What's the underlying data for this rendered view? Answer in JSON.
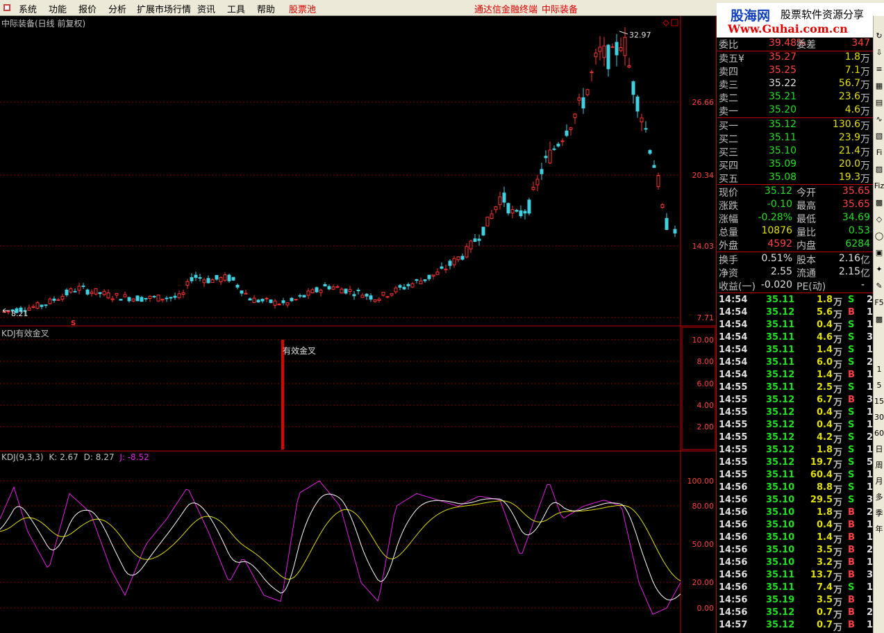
{
  "menu": {
    "items": [
      "系统",
      "功能",
      "报价",
      "分析",
      "扩展市场行情",
      "资讯",
      "工具",
      "帮助"
    ],
    "highlight": "股票池",
    "center_links": [
      "通达信金融终端",
      "中际装备"
    ]
  },
  "logo": {
    "name": "股海网",
    "slogan": "股票软件资源分享",
    "url": "Www.Guhai.com.cn"
  },
  "main_chart": {
    "title": "中际装备(日线 前复权)",
    "price_labels": [
      "26.66",
      "20.34",
      "14.03",
      "7.71"
    ],
    "high_label": "32.97",
    "low_label": "8.21",
    "marker": "S"
  },
  "kdj_cross": {
    "title": "KDJ有效金叉",
    "y_labels": [
      "10.00",
      "8.00",
      "6.00",
      "4.00",
      "2.00"
    ],
    "signal_label": "有效金叉"
  },
  "kdj": {
    "name": "KDJ(9,3,3)",
    "k": "K: 2.67",
    "d": "D: 8.27",
    "j": "J: -8.52",
    "y_labels": [
      "100.00",
      "80.00",
      "50.00",
      "20.00",
      "0.00"
    ]
  },
  "quote": {
    "weibi_label": "委比",
    "weibi": "39.48%",
    "weicha_label": "委差",
    "weicha": "347",
    "asks": [
      {
        "label": "卖五",
        "extra": "¥",
        "price": "35.27",
        "vol": "1.8",
        "unit": "万"
      },
      {
        "label": "卖四",
        "extra": "",
        "price": "35.25",
        "vol": "7.1",
        "unit": "万"
      },
      {
        "label": "卖三",
        "extra": "",
        "price": "35.22",
        "vol": "56.7",
        "unit": "万"
      },
      {
        "label": "卖二",
        "extra": "",
        "price": "35.21",
        "vol": "23.6",
        "unit": "万"
      },
      {
        "label": "卖一",
        "extra": "",
        "price": "35.20",
        "vol": "4.6",
        "unit": "万"
      }
    ],
    "bids": [
      {
        "label": "买一",
        "price": "35.12",
        "vol": "130.6",
        "unit": "万"
      },
      {
        "label": "买二",
        "price": "35.11",
        "vol": "23.9",
        "unit": "万"
      },
      {
        "label": "买三",
        "price": "35.10",
        "vol": "21.4",
        "unit": "万"
      },
      {
        "label": "买四",
        "price": "35.09",
        "vol": "20.0",
        "unit": "万"
      },
      {
        "label": "买五",
        "price": "35.08",
        "vol": "19.3",
        "unit": "万"
      }
    ],
    "stats": [
      {
        "l1": "现价",
        "v1": "35.12",
        "c1": "grn",
        "l2": "今开",
        "v2": "35.65",
        "c2": "red"
      },
      {
        "l1": "涨跌",
        "v1": "-0.10",
        "c1": "grn",
        "l2": "最高",
        "v2": "35.65",
        "c2": "red"
      },
      {
        "l1": "涨幅",
        "v1": "-0.28%",
        "c1": "grn",
        "l2": "最低",
        "v2": "34.69",
        "c2": "grn"
      },
      {
        "l1": "总量",
        "v1": "10876",
        "c1": "yel",
        "l2": "量比",
        "v2": "0.53",
        "c2": "grn"
      },
      {
        "l1": "外盘",
        "v1": "4592",
        "c1": "red",
        "l2": "内盘",
        "v2": "6284",
        "c2": "grn"
      }
    ],
    "stats2": [
      {
        "l1": "换手",
        "v1": "0.51%",
        "l2": "股本",
        "v2": "2.16",
        "u2": "亿"
      },
      {
        "l1": "净资",
        "v1": "2.55",
        "l2": "流通",
        "v2": "2.15",
        "u2": "亿"
      },
      {
        "l1": "收益(一)",
        "v1": "-0.020",
        "l2": "PE(动)",
        "v2": "-",
        "u2": ""
      }
    ],
    "ticks": [
      {
        "t": "14:54",
        "p": "35.11",
        "v": "1.8",
        "s": "S",
        "n": "2"
      },
      {
        "t": "14:54",
        "p": "35.12",
        "v": "5.6",
        "s": "B",
        "n": "1"
      },
      {
        "t": "14:54",
        "p": "35.11",
        "v": "0.4",
        "s": "S",
        "n": "1"
      },
      {
        "t": "14:54",
        "p": "35.11",
        "v": "4.6",
        "s": "S",
        "n": "3"
      },
      {
        "t": "14:54",
        "p": "35.11",
        "v": "1.4",
        "s": "S",
        "n": "1"
      },
      {
        "t": "14:54",
        "p": "35.11",
        "v": "6.0",
        "s": "S",
        "n": "2"
      },
      {
        "t": "14:54",
        "p": "35.12",
        "v": "1.4",
        "s": "B",
        "n": "1"
      },
      {
        "t": "14:55",
        "p": "35.11",
        "v": "2.5",
        "s": "S",
        "n": "1"
      },
      {
        "t": "14:55",
        "p": "35.12",
        "v": "6.7",
        "s": "B",
        "n": "3"
      },
      {
        "t": "14:55",
        "p": "35.12",
        "v": "0.4",
        "s": "S",
        "n": "1"
      },
      {
        "t": "14:55",
        "p": "35.12",
        "v": "0.4",
        "s": "S",
        "n": "1"
      },
      {
        "t": "14:55",
        "p": "35.12",
        "v": "4.2",
        "s": "S",
        "n": "2"
      },
      {
        "t": "14:55",
        "p": "35.12",
        "v": "1.8",
        "s": "S",
        "n": "1"
      },
      {
        "t": "14:55",
        "p": "35.12",
        "v": "19.7",
        "s": "S",
        "n": "5"
      },
      {
        "t": "14:55",
        "p": "35.11",
        "v": "60.4",
        "s": "S",
        "n": "1"
      },
      {
        "t": "14:56",
        "p": "35.10",
        "v": "8.8",
        "s": "S",
        "n": "1"
      },
      {
        "t": "14:56",
        "p": "35.10",
        "v": "29.5",
        "s": "S",
        "n": "3"
      },
      {
        "t": "14:56",
        "p": "35.10",
        "v": "1.8",
        "s": "B",
        "n": "2"
      },
      {
        "t": "14:56",
        "p": "35.10",
        "v": "0.4",
        "s": "B",
        "n": "1"
      },
      {
        "t": "14:56",
        "p": "35.10",
        "v": "1.4",
        "s": "B",
        "n": "1"
      },
      {
        "t": "14:56",
        "p": "35.10",
        "v": "3.5",
        "s": "B",
        "n": "2"
      },
      {
        "t": "14:56",
        "p": "35.10",
        "v": "3.2",
        "s": "B",
        "n": "1"
      },
      {
        "t": "14:56",
        "p": "35.11",
        "v": "13.7",
        "s": "B",
        "n": "3"
      },
      {
        "t": "14:56",
        "p": "35.11",
        "v": "7.4",
        "s": "S",
        "n": "1"
      },
      {
        "t": "14:56",
        "p": "35.19",
        "v": "3.5",
        "s": "B",
        "n": "1"
      },
      {
        "t": "14:56",
        "p": "35.12",
        "v": "0.7",
        "s": "B",
        "n": "2"
      },
      {
        "t": "14:57",
        "p": "35.12",
        "v": "0.7",
        "s": "B",
        "n": "1"
      }
    ],
    "unit": "万"
  },
  "sidebar": [
    "1",
    "5",
    "15",
    "30",
    "60",
    "日",
    "周",
    "月",
    "多",
    "季",
    "年"
  ],
  "colors": {
    "up": "#ff3030",
    "down": "#40d0e0",
    "k_line": "#ffffff",
    "d_line": "#e0e000",
    "j_line": "#e020e0"
  }
}
